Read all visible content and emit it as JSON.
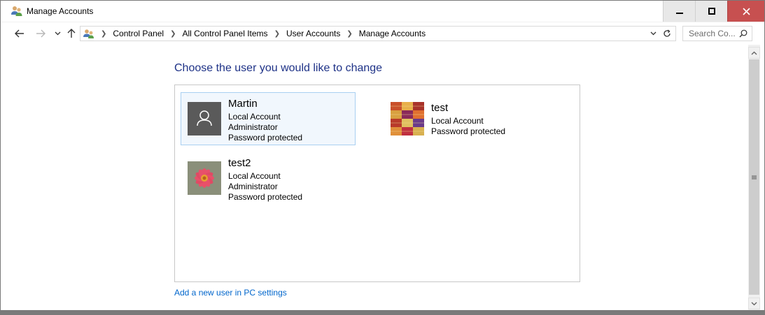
{
  "window": {
    "title": "Manage Accounts",
    "controls": {
      "minimize": "minimize",
      "maximize": "maximize",
      "close": "close"
    },
    "close_color": "#c75050"
  },
  "nav": {
    "breadcrumb": [
      "Control Panel",
      "All Control Panel Items",
      "User Accounts",
      "Manage Accounts"
    ],
    "search_placeholder": "Search Co..."
  },
  "main": {
    "heading": "Choose the user you would like to change",
    "accounts": [
      {
        "name": "Martin",
        "lines": [
          "Local Account",
          "Administrator",
          "Password protected"
        ],
        "picture": "default-user-avatar",
        "selected": true
      },
      {
        "name": "test",
        "lines": [
          "Local Account",
          "Password protected"
        ],
        "picture": "woven-fabric-photo",
        "selected": false
      },
      {
        "name": "test2",
        "lines": [
          "Local Account",
          "Administrator",
          "Password protected"
        ],
        "picture": "red-flower-photo",
        "selected": false
      }
    ],
    "add_user_link": "Add a new user in PC settings"
  },
  "colors": {
    "heading": "#1e3287",
    "link": "#0066cc",
    "selection_bg": "#f1f7fd",
    "selection_border": "#a9cff1"
  }
}
